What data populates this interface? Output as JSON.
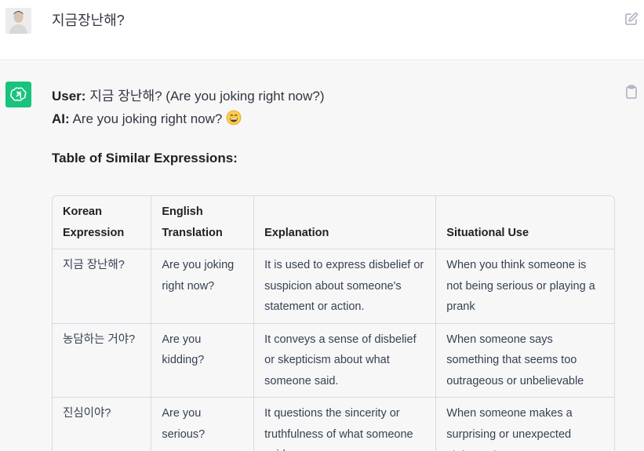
{
  "user_message": {
    "text": "지금장난해?"
  },
  "assistant_message": {
    "line1": {
      "speaker": "User:",
      "text": " 지금 장난해? (Are you joking right now?)"
    },
    "line2": {
      "speaker": "AI:",
      "text": " Are you joking right now? "
    },
    "emoji_icon": "grinning-face",
    "table_heading": "Table of Similar Expressions:",
    "table": {
      "headers": [
        "Korean Expression",
        "English Translation",
        "Explanation",
        "Situational Use"
      ],
      "rows": [
        [
          "지금 장난해?",
          "Are you joking right now?",
          "It is used to express disbelief or suspicion about someone's statement or action.",
          "When you think someone is not being serious or playing a prank"
        ],
        [
          "농담하는 거야?",
          "Are you kidding?",
          "It conveys a sense of disbelief or skepticism about what someone said.",
          "When someone says something that seems too outrageous or unbelievable"
        ],
        [
          "진심이야?",
          "Are you serious?",
          "It questions the sincerity or truthfulness of what someone said.",
          "When someone makes a surprising or unexpected statement"
        ]
      ]
    }
  },
  "icons": {
    "edit": "edit-icon",
    "copy": "clipboard-icon",
    "assistant_logo": "openai-logo-icon"
  },
  "colors": {
    "assistant_avatar_bg": "#19c37d",
    "assistant_row_bg": "#f7f7f8"
  }
}
